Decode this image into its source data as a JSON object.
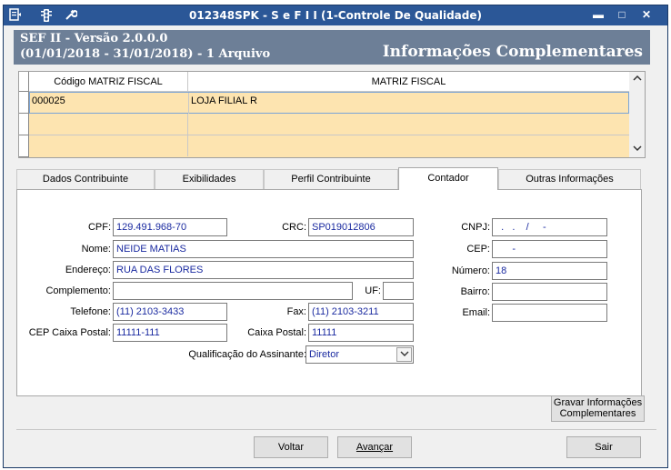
{
  "titlebar": {
    "title": "012348SPK - S e F  I I (1-Controle De Qualidade)",
    "icons": [
      "menu-icon",
      "traffic-light-icon",
      "wrench-icon"
    ],
    "minimize": "▬",
    "maximize": "□",
    "close": "✕"
  },
  "header": {
    "version": "SEF II - Versão 2.0.0.0",
    "period": "(01/01/2018 - 31/01/2018) - 1 Arquivo",
    "section_title": "Informações Complementares"
  },
  "grid": {
    "columns": [
      "Código MATRIZ FISCAL",
      "MATRIZ FISCAL"
    ],
    "rows": [
      {
        "code": "000025",
        "name": "LOJA FILIAL R"
      }
    ]
  },
  "tabs": [
    "Dados Contribuinte",
    "Exibilidades",
    "Perfil Contribuinte",
    "Contador",
    "Outras Informações"
  ],
  "active_tab": "Contador",
  "form": {
    "cpf_label": "CPF:",
    "cpf": "129.491.968-70",
    "crc_label": "CRC:",
    "crc": "SP019012806",
    "cnpj_label": "CNPJ:",
    "cnpj": "  .   .    /     -",
    "nome_label": "Nome:",
    "nome": "NEIDE MATIAS",
    "cep_label": "CEP:",
    "cep": "      -",
    "endereco_label": "Endereço:",
    "endereco": "RUA DAS FLORES",
    "numero_label": "Número:",
    "numero": "18",
    "complemento_label": "Complemento:",
    "complemento": "",
    "uf_label": "UF:",
    "uf": "",
    "bairro_label": "Bairro:",
    "bairro": "",
    "telefone_label": "Telefone:",
    "telefone": "(11) 2103-3433",
    "fax_label": "Fax:",
    "fax": "(11) 2103-3211",
    "email_label": "Email:",
    "email": "",
    "cep_caixa_postal_label": "CEP Caixa Postal:",
    "cep_caixa_postal": "11111-111",
    "caixa_postal_label": "Caixa Postal:",
    "caixa_postal": "11111",
    "qualificacao_label": "Qualificação do Assinante:",
    "qualificacao": "Diretor"
  },
  "buttons": {
    "gravar_line1": "Gravar Informações",
    "gravar_line2": "Complementares",
    "voltar": "Voltar",
    "avancar": "Avançar",
    "sair": "Sair"
  },
  "colors": {
    "titlebar": "#2b5797",
    "header": "#6d7f97",
    "selected_row": "#fde4b0",
    "input_text": "#1a2aa0"
  }
}
